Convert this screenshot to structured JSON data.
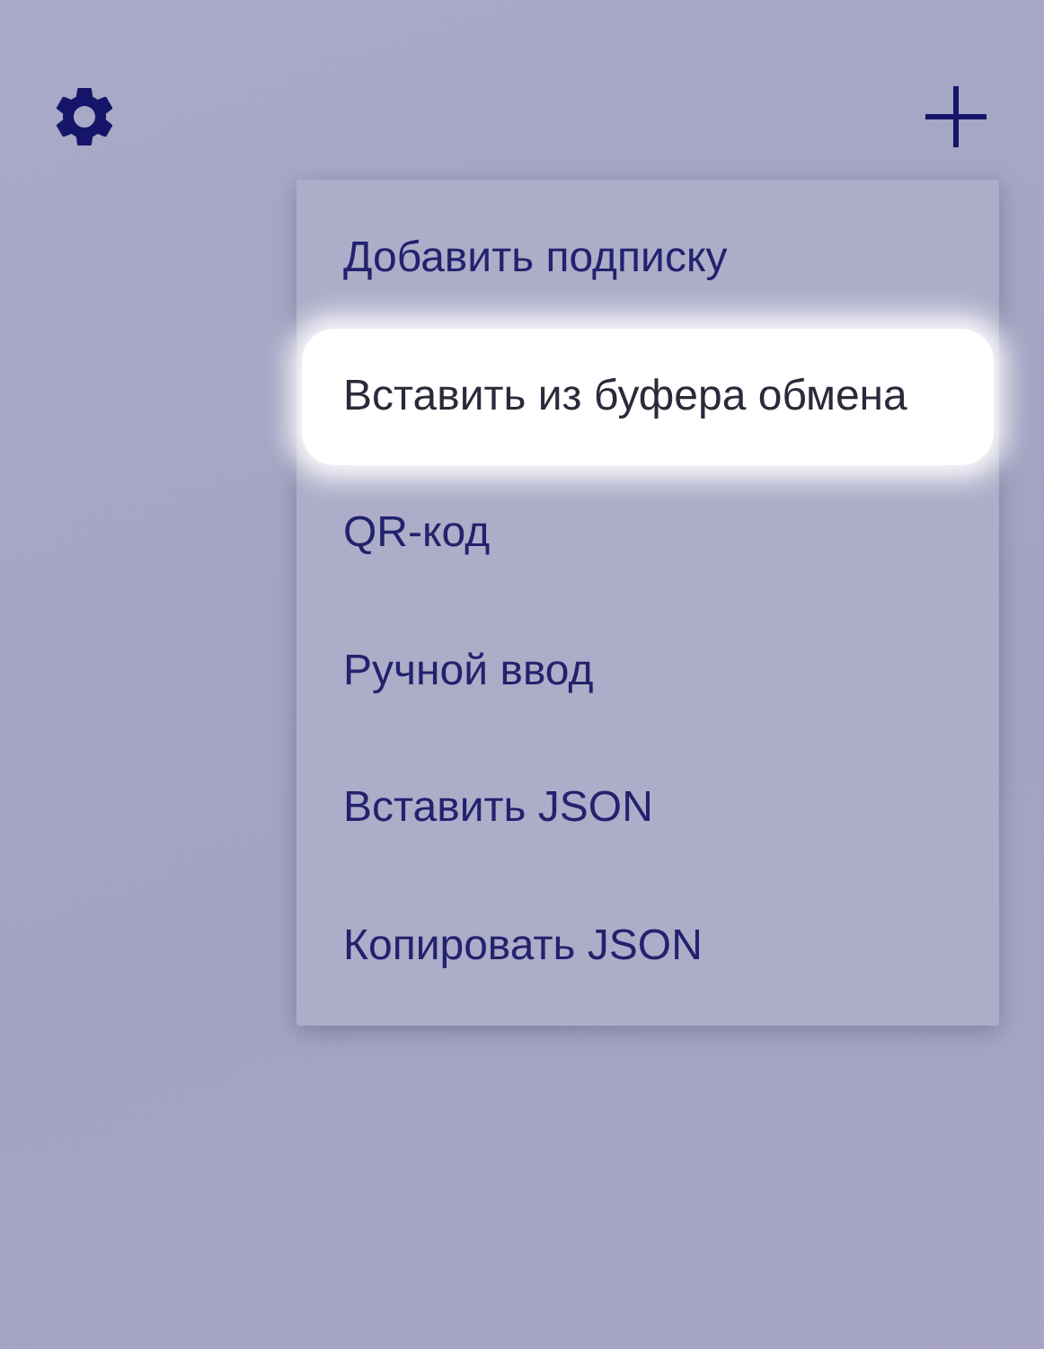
{
  "menu": {
    "items": [
      {
        "label": "Добавить подписку",
        "selected": false
      },
      {
        "label": "Вставить из буфера обмена",
        "selected": true
      },
      {
        "label": "QR-код",
        "selected": false
      },
      {
        "label": "Ручной ввод",
        "selected": false
      },
      {
        "label": "Вставить JSON",
        "selected": false
      },
      {
        "label": "Копировать JSON",
        "selected": false
      }
    ]
  }
}
